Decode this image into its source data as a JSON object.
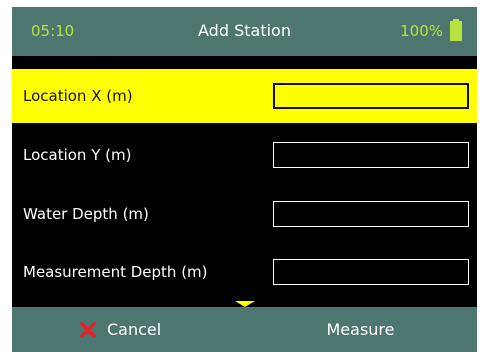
{
  "status_bar": {
    "time": "05:10",
    "title": "Add Station",
    "battery_text": "100%",
    "battery_level": 1.0,
    "accent_color": "#b9e23e",
    "background_color": "#4e7670"
  },
  "form": {
    "rows": [
      {
        "label": "Location X (m)",
        "value": "",
        "selected": true
      },
      {
        "label": "Location Y (m)",
        "value": "",
        "selected": false
      },
      {
        "label": "Water Depth (m)",
        "value": "",
        "selected": false
      },
      {
        "label": "Measurement Depth (m)",
        "value": "",
        "selected": false
      }
    ],
    "highlight_color": "#ffff00",
    "more_below_icon": "chevron-down-icon"
  },
  "bottom_bar": {
    "cancel_label": "Cancel",
    "cancel_icon": "close-icon",
    "cancel_icon_color": "#e8202a",
    "measure_label": "Measure"
  }
}
